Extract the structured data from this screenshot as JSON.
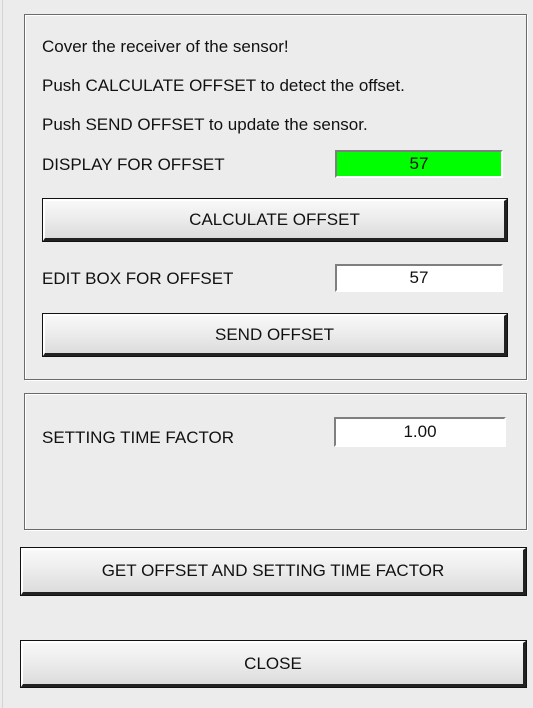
{
  "offset_panel": {
    "instructions": [
      "Cover the receiver of the sensor!",
      "Push CALCULATE OFFSET to detect the offset.",
      "Push SEND OFFSET to update the sensor."
    ],
    "display_label": "DISPLAY FOR OFFSET",
    "display_value": "57",
    "display_color": "#00ff00",
    "calculate_button": "CALCULATE OFFSET",
    "edit_label": "EDIT BOX FOR OFFSET",
    "edit_value": "57",
    "send_button": "SEND OFFSET"
  },
  "time_panel": {
    "label": "SETTING TIME FACTOR",
    "value": "1.00"
  },
  "get_button": "GET OFFSET AND SETTING TIME FACTOR",
  "close_button": "CLOSE"
}
